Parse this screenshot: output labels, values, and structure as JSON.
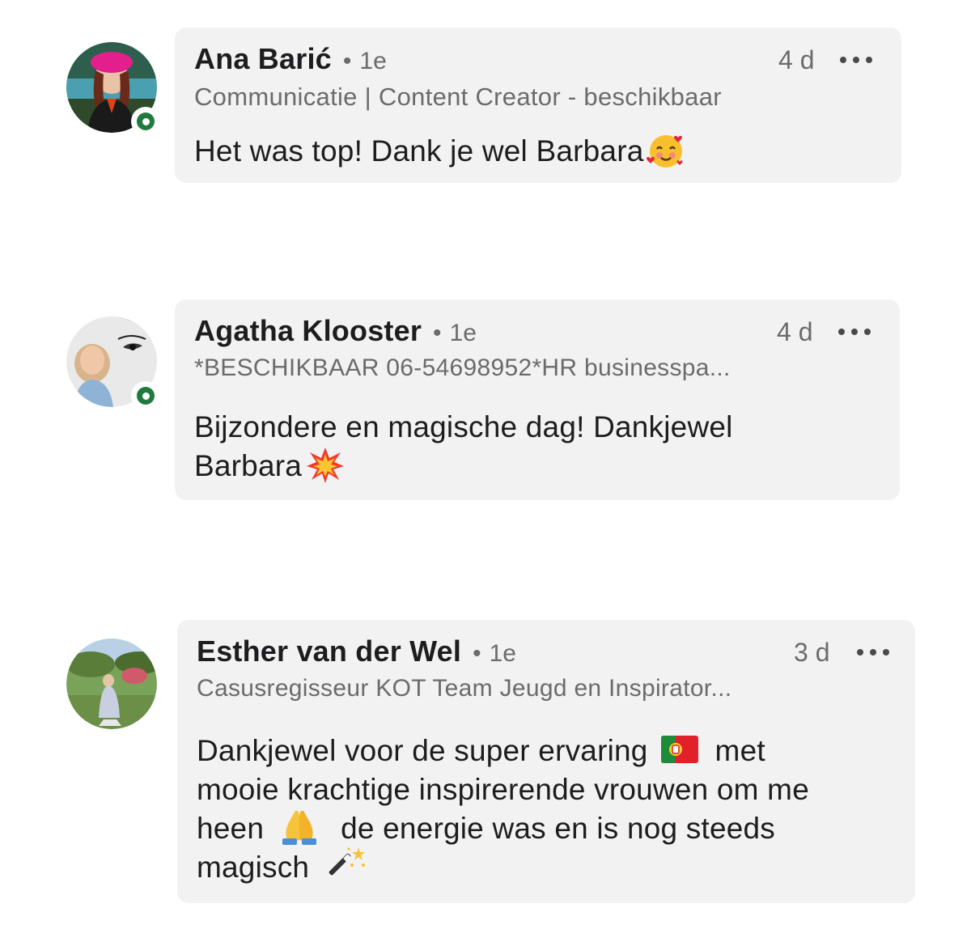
{
  "comments": [
    {
      "author": "Ana Barić",
      "degree": "1e",
      "time": "4 d",
      "headline": "Communicatie | Content Creator - beschikbaar",
      "text": "Het was top! Dank je wel Barbara",
      "emoji": "smiling-face-with-hearts",
      "online": true
    },
    {
      "author": "Agatha Klooster",
      "degree": "1e",
      "time": "4 d",
      "headline": "*BESCHIKBAAR 06-54698952*HR businesspa...",
      "text_line1": "Bijzondere en magische dag! Dankjewel",
      "text_line2": "Barbara",
      "emoji": "collision",
      "online": true
    },
    {
      "author": "Esther van der Wel",
      "degree": "1e",
      "time": "3 d",
      "headline": "Casusregisseur KOT Team Jeugd en Inspirator...",
      "text_line1a": "Dankjewel voor de super ervaring",
      "text_line1b": "met",
      "text_line2": "mooie krachtige inspirerende vrouwen om me",
      "text_line3a": "heen",
      "text_line3b": "de energie was en is nog steeds",
      "text_line4": "magisch",
      "emojis": [
        "flag-portugal",
        "folded-hands",
        "magic-wand"
      ],
      "online": false
    }
  ],
  "ui": {
    "degree_separator": "•"
  },
  "colors": {
    "bubble": "#f2f2f2",
    "online": "#1f7a3d",
    "secondary_text": "#6b6b6b"
  }
}
